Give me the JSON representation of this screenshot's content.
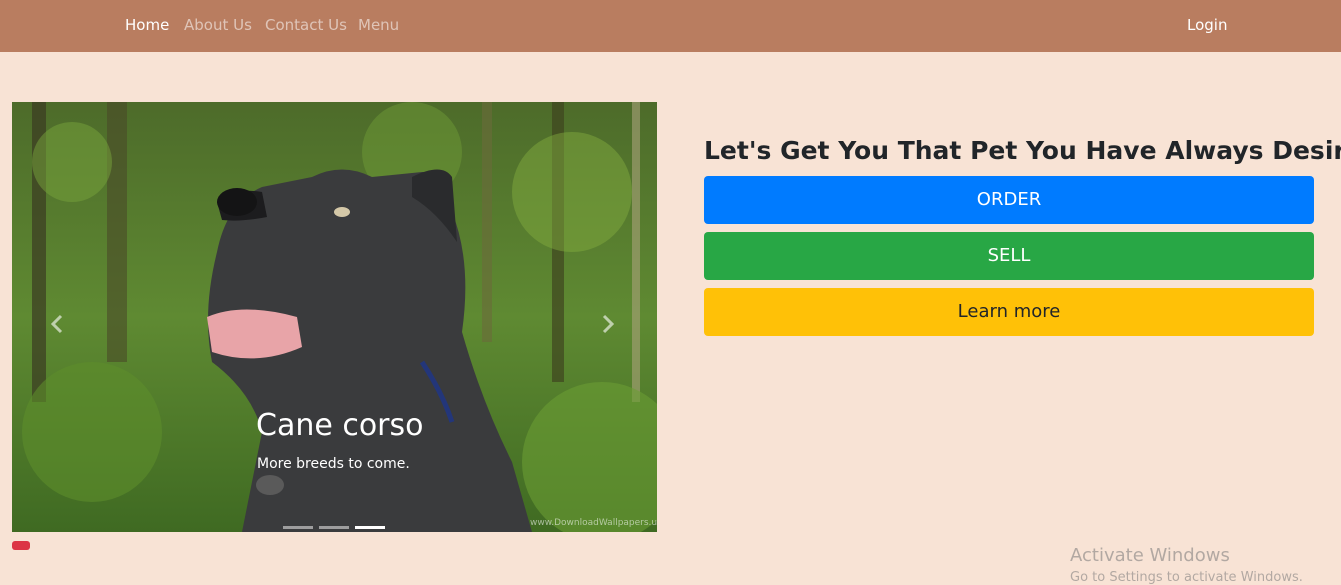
{
  "navbar": {
    "links": [
      "Home",
      "About Us",
      "Contact Us",
      "Menu"
    ],
    "login": "Login",
    "background": "#b97d60"
  },
  "carousel": {
    "caption_title": "Cane corso",
    "caption_text": "More breeds to come.",
    "watermark": "www.DownloadWallpapers.us",
    "prev_icon": "chevron-left-icon",
    "next_icon": "chevron-right-icon",
    "slide_count": 3,
    "active_slide": 3
  },
  "hero": {
    "headline": "Let's Get You That Pet You Have Always Desired",
    "buttons": {
      "order": "ORDER",
      "sell": "SELL",
      "learn": "Learn more"
    }
  },
  "system_overlay": {
    "title": "Activate Windows",
    "subtitle": "Go to Settings to activate Windows."
  },
  "colors": {
    "page_bg": "#f8e3d5",
    "order": "#007bff",
    "sell": "#28a745",
    "learn": "#ffc107",
    "badge": "#dc3545"
  }
}
